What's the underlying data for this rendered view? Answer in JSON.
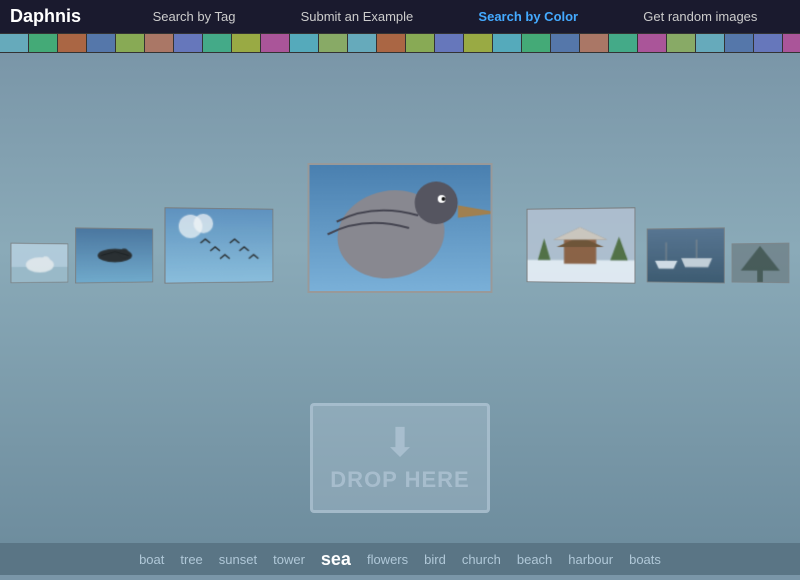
{
  "header": {
    "logo": "Daphnis",
    "nav": [
      {
        "id": "search-by-tag",
        "label": "Search by Tag",
        "active": false
      },
      {
        "id": "submit-example",
        "label": "Submit an Example",
        "active": false
      },
      {
        "id": "search-by-color",
        "label": "Search by Color",
        "active": true
      },
      {
        "id": "random-images",
        "label": "Get random images",
        "active": false
      }
    ]
  },
  "drop_zone": {
    "arrow": "⬇",
    "text": "DROP HERE"
  },
  "footer": {
    "tags": [
      {
        "label": "boat",
        "highlight": false
      },
      {
        "label": "tree",
        "highlight": false
      },
      {
        "label": "sunset",
        "highlight": false
      },
      {
        "label": "tower",
        "highlight": false
      },
      {
        "label": "sea",
        "highlight": true
      },
      {
        "label": "flowers",
        "highlight": false
      },
      {
        "label": "bird",
        "highlight": false
      },
      {
        "label": "church",
        "highlight": false
      },
      {
        "label": "beach",
        "highlight": false
      },
      {
        "label": "harbour",
        "highlight": false
      },
      {
        "label": "boats",
        "highlight": false
      }
    ]
  },
  "carousel": {
    "images": [
      {
        "id": "far-left",
        "bg": "#c8d8e0",
        "desc": "swan on water"
      },
      {
        "id": "left2",
        "bg": "#4a7ab0",
        "desc": "bird flying"
      },
      {
        "id": "left1",
        "bg": "#7ab0d0",
        "desc": "birds flying blue sky"
      },
      {
        "id": "center",
        "bg": "#5a8ab0",
        "desc": "pelican closeup"
      },
      {
        "id": "right1",
        "bg": "#8090a0",
        "desc": "pagoda in snow"
      },
      {
        "id": "right2",
        "bg": "#4a6888",
        "desc": "boats in harbour"
      },
      {
        "id": "far-right",
        "bg": "#6a7a80",
        "desc": "tree silhouette"
      }
    ]
  }
}
